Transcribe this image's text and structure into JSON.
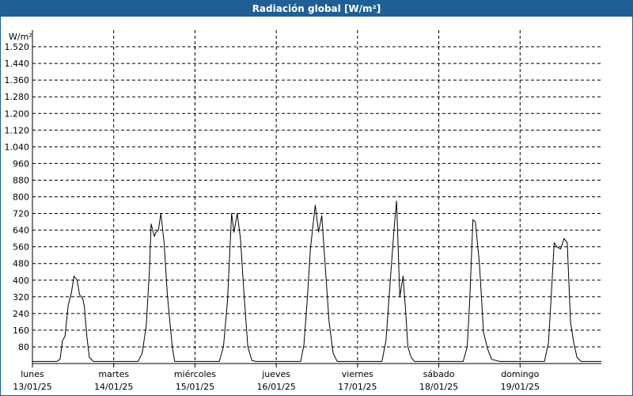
{
  "window": {
    "title": "Radiación global [W/m²]"
  },
  "colors": {
    "titlebar": "#1f5f96",
    "line": "#000000",
    "grid": "#000000",
    "background": "#ffffff"
  },
  "chart_data": {
    "type": "line",
    "title": "Radiación global [W/m²]",
    "ylabel": "W/m²",
    "xlabel": "",
    "ylim": [
      0,
      1600
    ],
    "xlim": [
      0,
      7
    ],
    "grid": true,
    "grid_style": "dashed",
    "legend": "none",
    "yticks": [
      {
        "value": 80,
        "label": "80"
      },
      {
        "value": 160,
        "label": "160"
      },
      {
        "value": 240,
        "label": "240"
      },
      {
        "value": 320,
        "label": "320"
      },
      {
        "value": 400,
        "label": "400"
      },
      {
        "value": 480,
        "label": "480"
      },
      {
        "value": 560,
        "label": "560"
      },
      {
        "value": 640,
        "label": "640"
      },
      {
        "value": 720,
        "label": "720"
      },
      {
        "value": 800,
        "label": "800"
      },
      {
        "value": 880,
        "label": "880"
      },
      {
        "value": 960,
        "label": "960"
      },
      {
        "value": 1040,
        "label": "1.040"
      },
      {
        "value": 1120,
        "label": "1.120"
      },
      {
        "value": 1200,
        "label": "1.200"
      },
      {
        "value": 1280,
        "label": "1.280"
      },
      {
        "value": 1360,
        "label": "1.360"
      },
      {
        "value": 1440,
        "label": "1.440"
      },
      {
        "value": 1520,
        "label": "1.520"
      }
    ],
    "xticks": [
      {
        "value": 0,
        "day": "lunes",
        "date": "13/01/25"
      },
      {
        "value": 1,
        "day": "martes",
        "date": "14/01/25"
      },
      {
        "value": 2,
        "day": "miércoles",
        "date": "15/01/25"
      },
      {
        "value": 3,
        "day": "jueves",
        "date": "16/01/25"
      },
      {
        "value": 4,
        "day": "viernes",
        "date": "17/01/25"
      },
      {
        "value": 5,
        "day": "sábado",
        "date": "18/01/25"
      },
      {
        "value": 6,
        "day": "domingo",
        "date": "19/01/25"
      }
    ],
    "series": [
      {
        "x": [
          0,
          0.3,
          0.34,
          0.37,
          0.4,
          0.44,
          0.48,
          0.51,
          0.55,
          0.58,
          0.62,
          0.64,
          0.67,
          0.7,
          0.75,
          1.3,
          1.35,
          1.4,
          1.44,
          1.46,
          1.5,
          1.52,
          1.55,
          1.58,
          1.62,
          1.66,
          1.72,
          1.75,
          2.3,
          2.35,
          2.4,
          2.45,
          2.48,
          2.52,
          2.56,
          2.6,
          2.65,
          2.7,
          2.75,
          3.3,
          3.34,
          3.38,
          3.42,
          3.48,
          3.52,
          3.56,
          3.6,
          3.65,
          3.7,
          3.75,
          4.3,
          4.35,
          4.4,
          4.45,
          4.48,
          4.52,
          4.56,
          4.59,
          4.62,
          4.66,
          4.7,
          4.75,
          5.3,
          5.35,
          5.38,
          5.42,
          5.45,
          5.5,
          5.55,
          5.6,
          5.65,
          5.75,
          6.3,
          6.35,
          6.38,
          6.42,
          6.45,
          6.5,
          6.54,
          6.58,
          6.62,
          6.66,
          6.7,
          6.75,
          7.0
        ],
        "values": [
          10,
          10,
          20,
          110,
          130,
          280,
          340,
          420,
          400,
          330,
          310,
          270,
          130,
          30,
          10,
          10,
          50,
          180,
          450,
          670,
          610,
          630,
          640,
          720,
          580,
          330,
          80,
          10,
          10,
          80,
          300,
          720,
          630,
          720,
          600,
          350,
          80,
          15,
          10,
          10,
          90,
          300,
          550,
          760,
          630,
          710,
          480,
          200,
          50,
          10,
          10,
          110,
          380,
          650,
          780,
          320,
          420,
          260,
          80,
          30,
          10,
          10,
          10,
          80,
          300,
          690,
          680,
          480,
          150,
          70,
          20,
          10,
          10,
          100,
          300,
          580,
          560,
          550,
          600,
          580,
          200,
          100,
          30,
          10,
          10
        ]
      }
    ]
  }
}
